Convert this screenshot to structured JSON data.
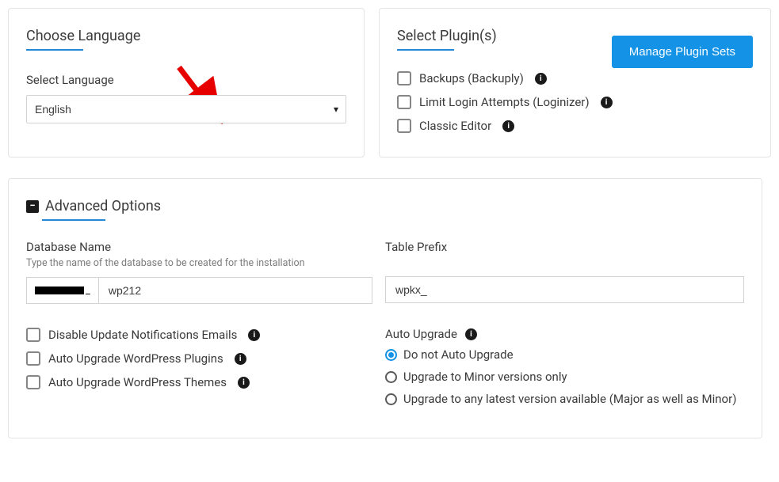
{
  "language_panel": {
    "title": "Choose Language",
    "field_label": "Select Language",
    "value": "English"
  },
  "plugins_panel": {
    "title": "Select Plugin(s)",
    "manage_button": "Manage Plugin Sets",
    "items": [
      {
        "label": "Backups (Backuply)"
      },
      {
        "label": "Limit Login Attempts (Loginizer)"
      },
      {
        "label": "Classic Editor"
      }
    ]
  },
  "advanced": {
    "title": "Advanced Options",
    "db_name_label": "Database Name",
    "db_name_hint": "Type the name of the database to be created for the installation",
    "db_prefix_suffix": "_",
    "db_name_value": "wp212",
    "table_prefix_label": "Table Prefix",
    "table_prefix_value": "wpkx_",
    "checks": [
      {
        "label": "Disable Update Notifications Emails"
      },
      {
        "label": "Auto Upgrade WordPress Plugins"
      },
      {
        "label": "Auto Upgrade WordPress Themes"
      }
    ],
    "auto_upgrade_label": "Auto Upgrade",
    "auto_upgrade_options": [
      {
        "label": "Do not Auto Upgrade",
        "checked": true
      },
      {
        "label": "Upgrade to Minor versions only",
        "checked": false
      },
      {
        "label": "Upgrade to any latest version available (Major as well as Minor)",
        "checked": false
      }
    ]
  }
}
